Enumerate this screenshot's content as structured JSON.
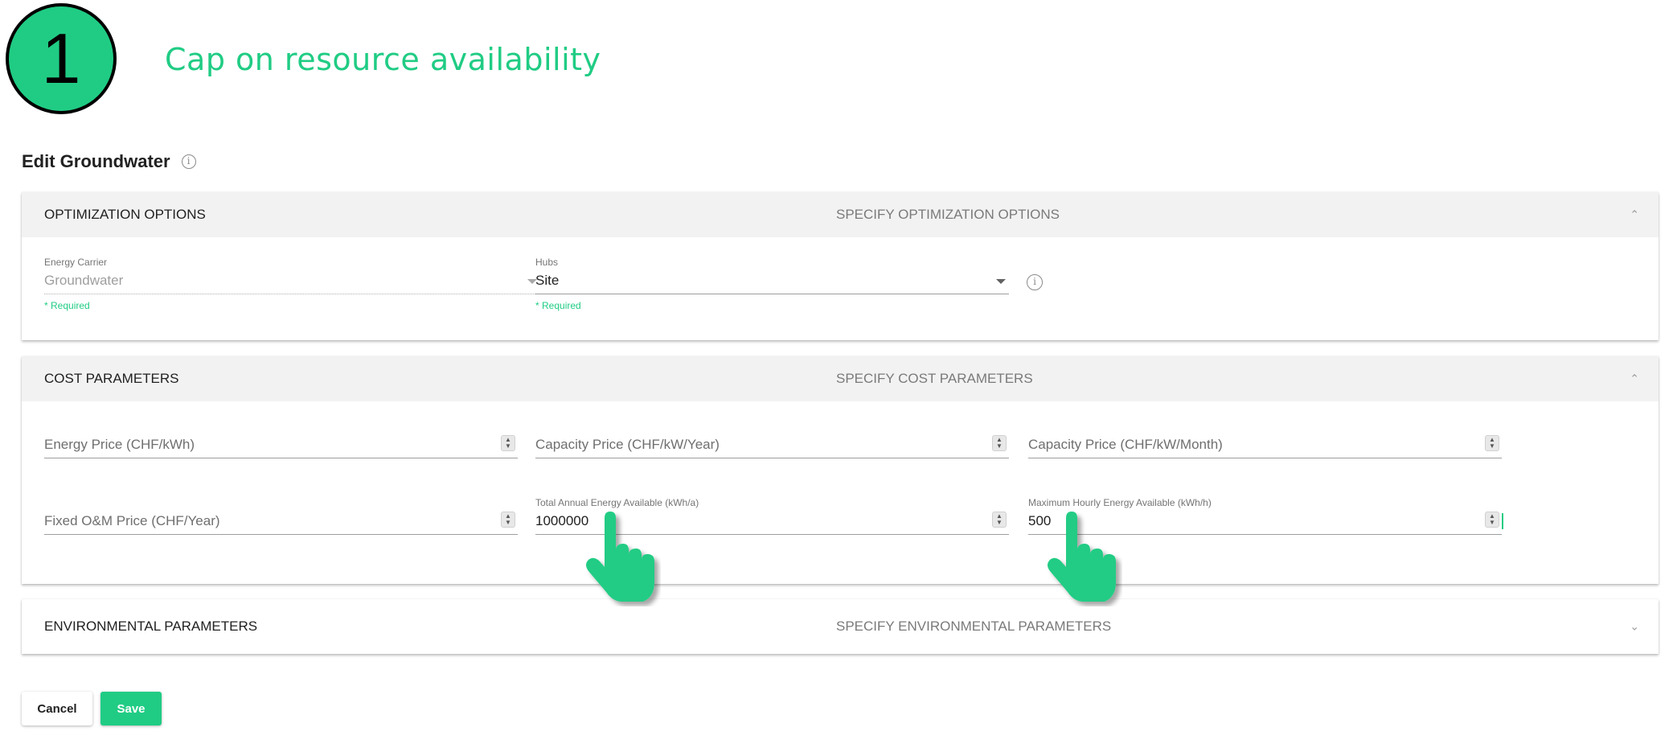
{
  "step": {
    "number": "1",
    "title": "Cap on resource availability"
  },
  "page_title": "Edit Groundwater",
  "panels": {
    "optimization": {
      "title": "OPTIMIZATION OPTIONS",
      "description": "SPECIFY OPTIMIZATION OPTIONS",
      "expanded": true,
      "fields": {
        "energy_carrier": {
          "label": "Energy Carrier",
          "value": "Groundwater",
          "hint": "* Required",
          "disabled": true
        },
        "hubs": {
          "label": "Hubs",
          "value": "Site",
          "hint": "* Required"
        }
      }
    },
    "cost": {
      "title": "COST PARAMETERS",
      "description": "SPECIFY COST PARAMETERS",
      "expanded": true,
      "fields": {
        "energy_price": {
          "placeholder": "Energy Price (CHF/kWh)"
        },
        "capacity_price_year": {
          "placeholder": "Capacity Price (CHF/kW/Year)"
        },
        "capacity_price_month": {
          "placeholder": "Capacity Price (CHF/kW/Month)"
        },
        "fixed_om_price": {
          "placeholder": "Fixed O&M Price (CHF/Year)"
        },
        "total_annual_energy": {
          "label": "Total Annual Energy Available (kWh/a)",
          "value": "1000000"
        },
        "max_hourly_energy": {
          "label": "Maximum Hourly Energy Available (kWh/h)",
          "value": "500"
        }
      }
    },
    "environmental": {
      "title": "ENVIRONMENTAL PARAMETERS",
      "description": "SPECIFY ENVIRONMENTAL PARAMETERS",
      "expanded": false
    }
  },
  "buttons": {
    "cancel": "Cancel",
    "save": "Save"
  },
  "colors": {
    "accent": "#20cc84",
    "header_bg": "#f2f2f2"
  },
  "icons": {
    "info": "info-icon",
    "pointer": "pointing-hand-icon"
  }
}
